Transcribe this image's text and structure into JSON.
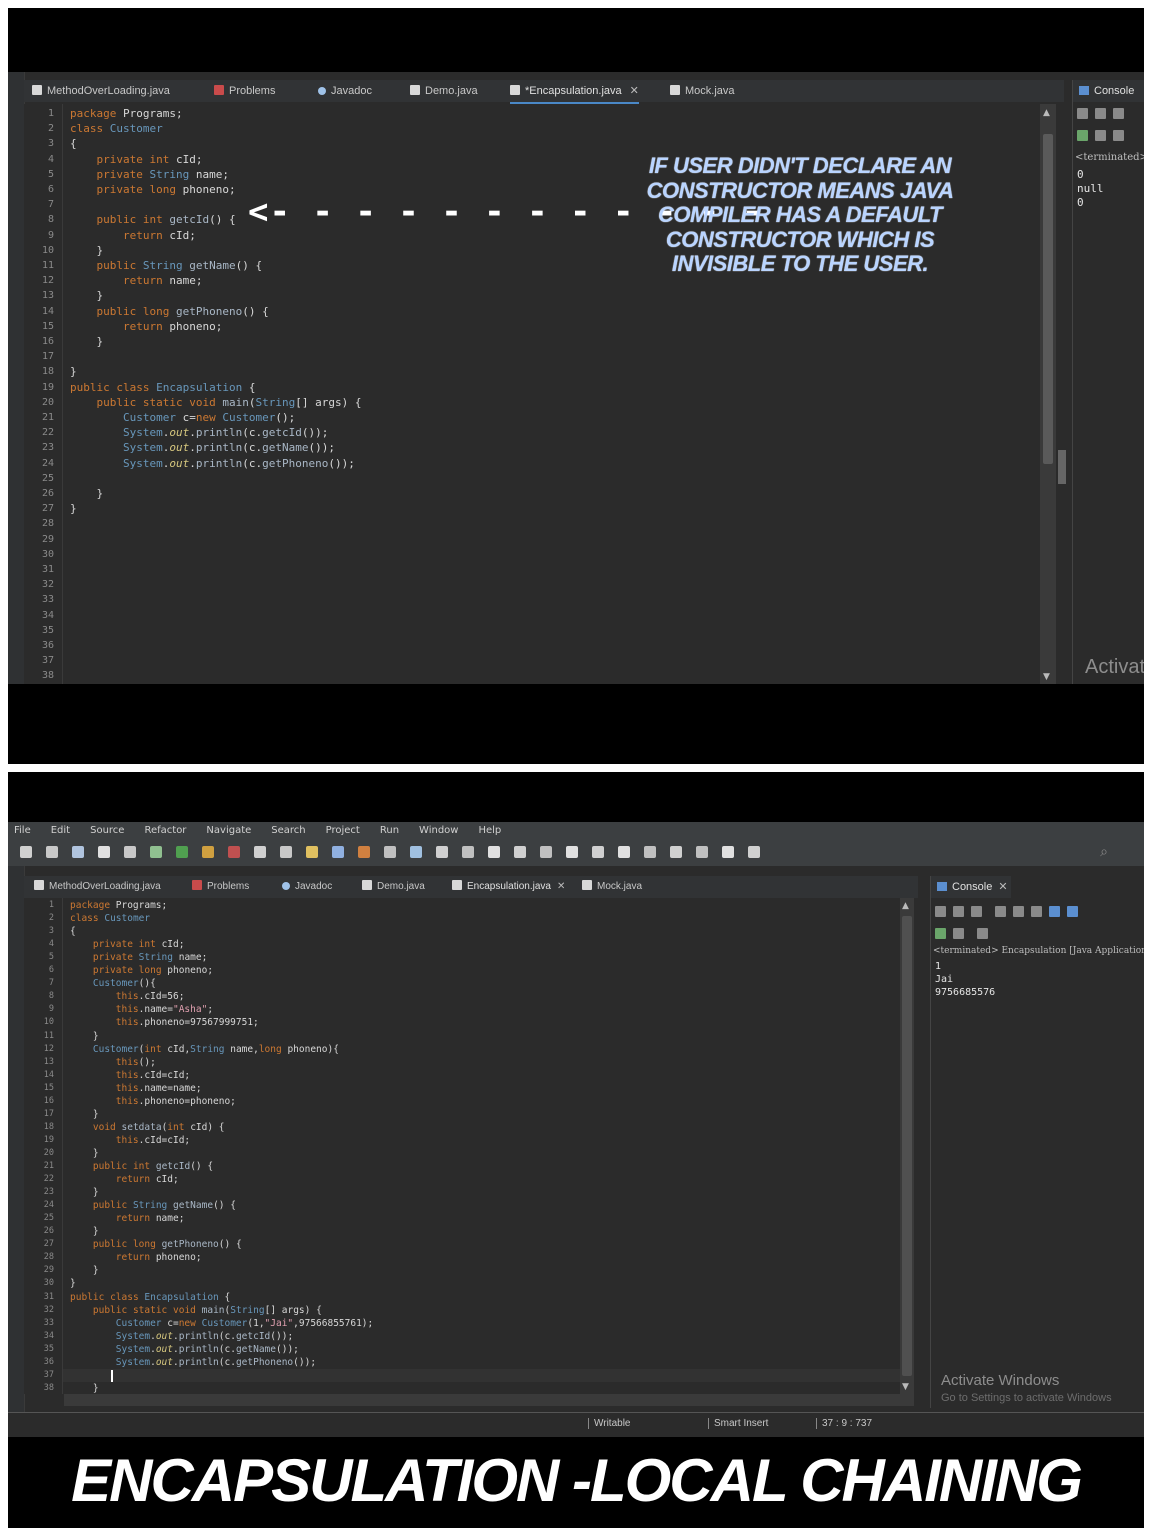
{
  "top": {
    "tabs": [
      {
        "label": "MethodOverLoading.java"
      },
      {
        "label": "Problems"
      },
      {
        "label": "Javadoc"
      },
      {
        "label": "Demo.java"
      },
      {
        "label": "*Encapsulation.java"
      },
      {
        "label": "Mock.java"
      }
    ],
    "console": {
      "title": "Console",
      "terminated": "<terminated>",
      "output": [
        "0",
        "null",
        "0"
      ],
      "watermark": "Activat"
    },
    "annotation": "IF USER DIDN'T DECLARE  AN CONSTRUCTOR MEANS JAVA COMPILER HAS A DEFAULT CONSTRUCTOR WHICH IS INVISIBLE TO THE USER.",
    "arrow": "<- - - - - - - - - - - -",
    "line_numbers": [
      "1",
      "2",
      "3",
      "4",
      "5",
      "6",
      "7",
      "8",
      "9",
      "10",
      "11",
      "12",
      "13",
      "14",
      "15",
      "16",
      "17",
      "18",
      "19",
      "20",
      "21",
      "22",
      "23",
      "24",
      "25",
      "26",
      "27",
      "28",
      "29",
      "30",
      "31",
      "32",
      "33",
      "34",
      "35",
      "36",
      "37",
      "38"
    ],
    "code": [
      "package Programs;",
      "class Customer",
      "{",
      "    private int cId;",
      "    private String name;",
      "    private long phoneno;",
      "",
      "    public int getcId() {",
      "        return cId;",
      "    }",
      "    public String getName() {",
      "        return name;",
      "    }",
      "    public long getPhoneno() {",
      "        return phoneno;",
      "    }",
      "",
      "}",
      "public class Encapsulation {",
      "    public static void main(String[] args) {",
      "        Customer c=new Customer();",
      "        System.out.println(c.getcId());",
      "        System.out.println(c.getName());",
      "        System.out.println(c.getPhoneno());",
      "",
      "    }",
      "}",
      "",
      "",
      "",
      "",
      "",
      "",
      "",
      "",
      "",
      "",
      ""
    ]
  },
  "bottom": {
    "menu": [
      "File",
      "Edit",
      "Source",
      "Refactor",
      "Navigate",
      "Search",
      "Project",
      "Run",
      "Window",
      "Help"
    ],
    "tabs": [
      {
        "label": "MethodOverLoading.java"
      },
      {
        "label": "Problems"
      },
      {
        "label": "Javadoc"
      },
      {
        "label": "Demo.java"
      },
      {
        "label": "Encapsulation.java"
      },
      {
        "label": "Mock.java"
      }
    ],
    "console": {
      "title": "Console",
      "terminated": "<terminated> Encapsulation [Java Application",
      "output": [
        "1",
        "Jai",
        "9756685576"
      ],
      "watermark": "Activate Windows",
      "watermark_sub": "Go to Settings to activate Windows"
    },
    "line_numbers": [
      "1",
      "2",
      "3",
      "4",
      "5",
      "6",
      "7",
      "8",
      "9",
      "10",
      "11",
      "12",
      "13",
      "14",
      "15",
      "16",
      "17",
      "18",
      "19",
      "20",
      "21",
      "22",
      "23",
      "24",
      "25",
      "26",
      "27",
      "28",
      "29",
      "30",
      "31",
      "32",
      "33",
      "34",
      "35",
      "36",
      "37",
      "38"
    ],
    "code": [
      "package Programs;",
      "class Customer",
      "{",
      "    private int cId;",
      "    private String name;",
      "    private long phoneno;",
      "    Customer(){",
      "        this.cId=56;",
      "        this.name=\"Asha\";",
      "        this.phoneno=97567999751;",
      "    }",
      "    Customer(int cId,String name,long phoneno){",
      "        this();",
      "        this.cId=cId;",
      "        this.name=name;",
      "        this.phoneno=phoneno;",
      "    }",
      "    void setdata(int cId) {",
      "        this.cId=cId;",
      "    }",
      "    public int getcId() {",
      "        return cId;",
      "    }",
      "    public String getName() {",
      "        return name;",
      "    }",
      "    public long getPhoneno() {",
      "        return phoneno;",
      "    }",
      "}",
      "public class Encapsulation {",
      "    public static void main(String[] args) {",
      "        Customer c=new Customer(1,\"Jai\",97566855761);",
      "        System.out.println(c.getcId());",
      "        System.out.println(c.getName());",
      "        System.out.println(c.getPhoneno());",
      "",
      "    }"
    ],
    "status": {
      "writable": "Writable",
      "insert": "Smart Insert",
      "position": "37 : 9 : 737"
    },
    "caption": "ENCAPSULATION -LOCAL CHAINING"
  },
  "colors": {
    "editor_bg": "#2b2b2b",
    "keyword": "#cc7832",
    "type": "#6897bb",
    "annotation": "#b9d4ff",
    "active_tab": "#4a88c7"
  }
}
